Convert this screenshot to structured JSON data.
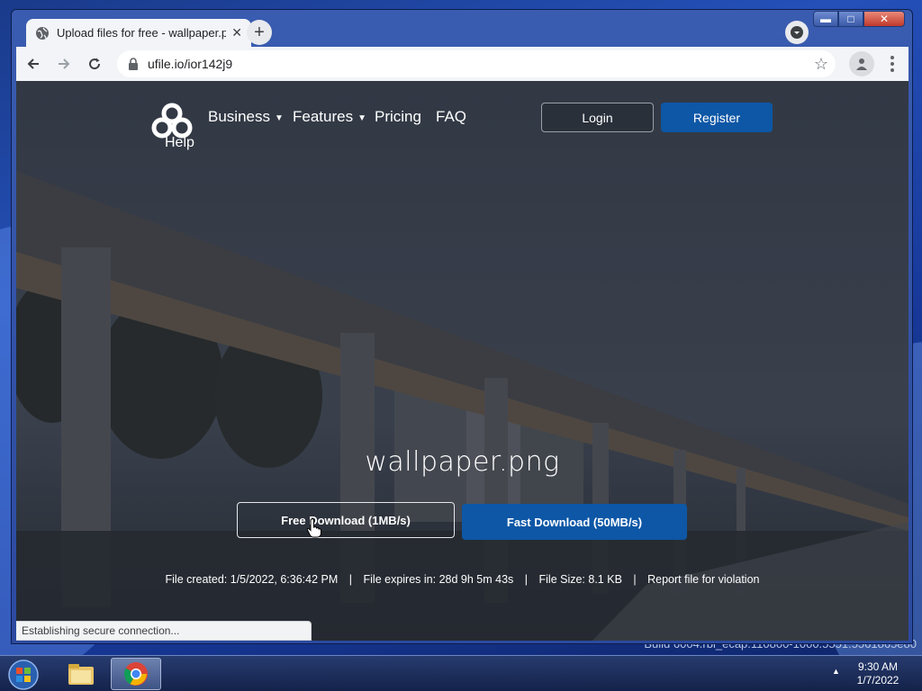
{
  "browser": {
    "tab_title": "Upload files for free - wallpaper.p",
    "url": "ufile.io/ior142j9",
    "status_text": "Establishing secure connection..."
  },
  "site": {
    "logo_label": "Help",
    "nav": [
      {
        "label": "Business",
        "has_dropdown": true
      },
      {
        "label": "Features",
        "has_dropdown": true
      },
      {
        "label": "Pricing",
        "has_dropdown": false
      },
      {
        "label": "FAQ",
        "has_dropdown": false
      }
    ],
    "login_label": "Login",
    "register_label": "Register",
    "file_name": "wallpaper.png",
    "free_download_label": "Free Download (1MB/s)",
    "fast_download_label": "Fast Download (50MB/s)",
    "file_info": {
      "created": "File created: 1/5/2022, 6:36:42 PM",
      "expires": "File expires in: 28d 9h 5m 43s",
      "size": "File Size: 8.1 KB",
      "report": "Report file for violation",
      "separator": "|"
    }
  },
  "desktop": {
    "build_text": "Build 6004.rbl_ecap.110800-1000.5551.5561865e80",
    "time": "9:30 AM",
    "date": "1/7/2022"
  },
  "colors": {
    "accent": "#0d57a6",
    "chrome_bg": "#f2f4f7"
  }
}
